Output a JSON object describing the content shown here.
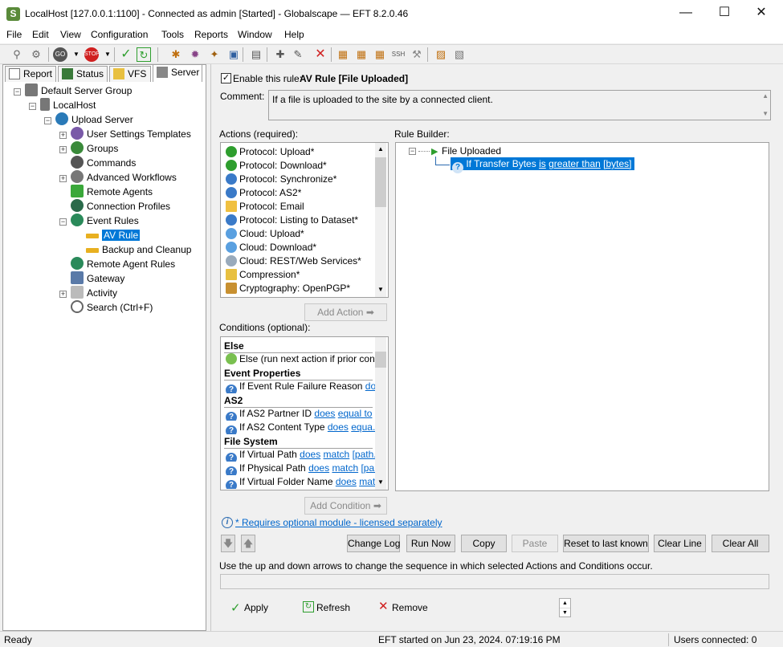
{
  "window": {
    "title": "LocalHost [127.0.0.1:1100] - Connected as admin [Started] - Globalscape — EFT 8.2.0.46",
    "minimize": "—",
    "maximize": "☐",
    "close": "✕",
    "logo": "S"
  },
  "menu": [
    "File",
    "Edit",
    "View",
    "Configuration",
    "Tools",
    "Reports",
    "Window",
    "Help"
  ],
  "left_tabs": [
    "Report",
    "Status",
    "VFS",
    "Server"
  ],
  "tree": {
    "server_group": "Default Server Group",
    "localhost": "LocalHost",
    "site": "Upload Server",
    "children": [
      "User Settings Templates",
      "Groups",
      "Commands",
      "Advanced Workflows",
      "Remote Agents",
      "Connection Profiles",
      "Event Rules"
    ],
    "event_rules": [
      "AV Rule",
      "Backup and Cleanup"
    ],
    "after": [
      "Remote Agent Rules",
      "Gateway",
      "Activity",
      "Search (Ctrl+F)"
    ]
  },
  "rule": {
    "enable_label": "Enable this rule:",
    "name": "AV Rule [File Uploaded]",
    "comment_label": "Comment:",
    "comment": "If a file is uploaded to the site by a connected client."
  },
  "actions": {
    "label": "Actions (required):",
    "items": [
      "Protocol: Upload*",
      "Protocol: Download*",
      "Protocol: Synchronize*",
      "Protocol: AS2*",
      "Protocol: Email",
      "Protocol: Listing to Dataset*",
      "Cloud: Upload*",
      "Cloud: Download*",
      "Cloud: REST/Web Services*",
      "Compression*",
      "Cryptography: OpenPGP*"
    ],
    "add_button": "Add Action"
  },
  "conditions": {
    "label": "Conditions (optional):",
    "h_else": "Else",
    "else_item": "Else (run next action if prior con...",
    "h_event": "Event Properties",
    "event_prefix": "If Event Rule Failure Reason",
    "event_link": "does",
    "h_as2": "AS2",
    "as2_1_prefix": "If AS2 Partner ID",
    "as2_1_l1": "does",
    "as2_1_l2": "equal to",
    "as2_1_l3": "[...",
    "as2_2_prefix": "If AS2 Content Type",
    "as2_2_l1": "does",
    "as2_2_l2": "equa...",
    "h_fs": "File System",
    "fs_1_prefix": "If Virtual Path",
    "fs_1_l1": "does",
    "fs_1_l2": "match",
    "fs_1_l3": "[path...",
    "fs_2_prefix": "If Physical Path",
    "fs_2_l1": "does",
    "fs_2_l2": "match",
    "fs_2_l3": "[pa...",
    "fs_3_prefix": "If Virtual Folder Name",
    "fs_3_l1": "does",
    "fs_3_l2": "match",
    "add_button": "Add Condition"
  },
  "rule_builder": {
    "label": "Rule Builder:",
    "trigger": "File Uploaded",
    "cond_prefix": "If Transfer Bytes",
    "cond_l1": "is",
    "cond_l2": "greater than",
    "cond_l3": "[bytes]"
  },
  "licensed_note": "* Requires optional module - licensed separately",
  "buttons": {
    "change_log": "Change Log",
    "run_now": "Run Now",
    "copy": "Copy",
    "paste": "Paste",
    "reset": "Reset to last known",
    "clear_line": "Clear Line",
    "clear_all": "Clear All"
  },
  "hint": "Use the up and down arrows to change the sequence in which selected Actions and Conditions occur.",
  "footer": {
    "apply": "Apply",
    "refresh": "Refresh",
    "remove": "Remove"
  },
  "status": {
    "left": "Ready",
    "center": "EFT started on Jun 23, 2024. 07:19:16 PM",
    "right": "Users connected: 0"
  },
  "colors": {
    "accent": "#0078d7",
    "link": "#0066cc",
    "green": "#2e9e2e",
    "red": "#d02020"
  }
}
